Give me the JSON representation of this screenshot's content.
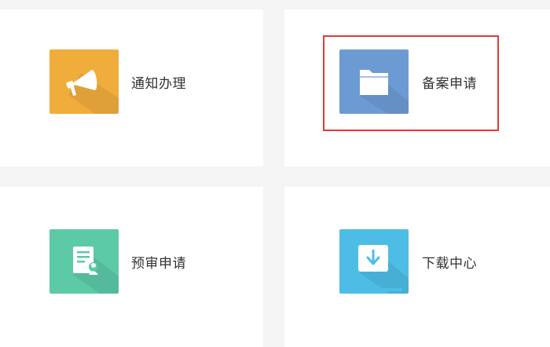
{
  "tiles": [
    {
      "label": "通知办理",
      "icon": "megaphone-icon",
      "color": "#f0ad3c"
    },
    {
      "label": "备案申请",
      "icon": "folder-icon",
      "color": "#6c9bd4"
    },
    {
      "label": "预审申请",
      "icon": "document-user-icon",
      "color": "#5cc9a7"
    },
    {
      "label": "下载中心",
      "icon": "download-icon",
      "color": "#4ebde5"
    }
  ],
  "selection": {
    "color": "#e53935",
    "selected_tile": "备案申请"
  }
}
